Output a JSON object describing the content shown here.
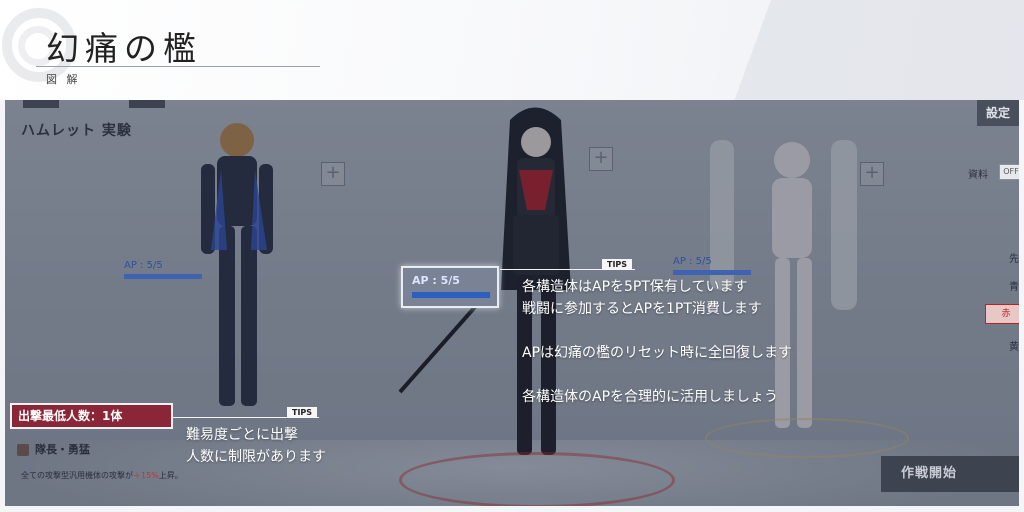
{
  "header": {
    "title": "幻痛の檻",
    "subtitle": "図 解"
  },
  "game": {
    "team_name": "ハムレット 実験",
    "settings_label": "設定",
    "data_label": "資料",
    "data_toggle": "OFF",
    "side_labels": [
      "先",
      "青",
      "赤",
      "黄"
    ],
    "skill_label": "隊長・勇猛",
    "buff_text_prefix": "全ての攻撃型汎用機体の攻撃が",
    "buff_text_value": "＋15%",
    "buff_text_suffix": "上昇。",
    "start_button": "作戦開始",
    "plus_symbol": "+",
    "characters": [
      {
        "ap_label": "AP : 5/5",
        "ap_current": 5,
        "ap_max": 5
      },
      {
        "ap_label": "AP : 5/5",
        "ap_current": 5,
        "ap_max": 5
      },
      {
        "ap_label": "AP : 5/5",
        "ap_current": 5,
        "ap_max": 5
      }
    ]
  },
  "tips": {
    "tag": "TIPS",
    "ap_box_label": "AP : 5/5",
    "ap_lines": [
      "各構造体はAPを5PT保有しています",
      "戦闘に参加するとAPを1PT消費します",
      "",
      "APは幻痛の檻のリセット時に全回復します",
      "",
      "各構造体のAPを合理的に活用しましょう"
    ],
    "min_label": "出撃最低人数：1体",
    "min_lines": [
      "難易度ごとに出撃",
      "人数に制限があります"
    ]
  },
  "colors": {
    "accent_red": "#8a2638",
    "ap_blue": "#3f63b0",
    "dim_overlay": "rgba(30,36,52,0.38)"
  }
}
